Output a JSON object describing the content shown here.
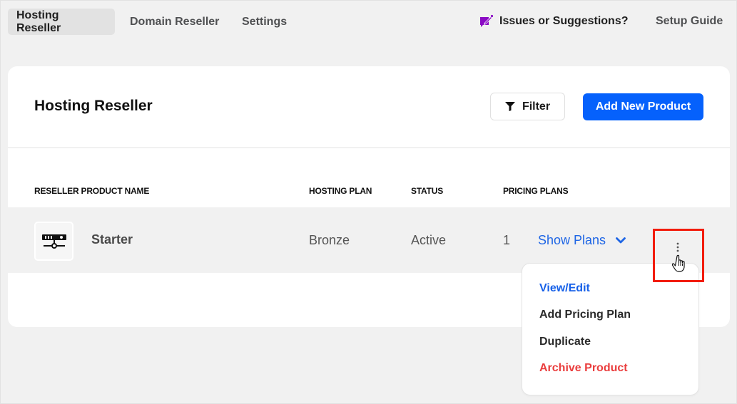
{
  "nav": {
    "tabs": [
      {
        "label": "Hosting Reseller",
        "active": true
      },
      {
        "label": "Domain Reseller",
        "active": false
      },
      {
        "label": "Settings",
        "active": false
      }
    ],
    "issues_label": "Issues or Suggestions?",
    "issues_icon": "feedback-pen-icon",
    "setup_label": "Setup Guide"
  },
  "card": {
    "title": "Hosting Reseller",
    "filter_label": "Filter",
    "filter_icon": "funnel-icon",
    "add_label": "Add New Product"
  },
  "table": {
    "columns": [
      "RESELLER PRODUCT NAME",
      "HOSTING PLAN",
      "STATUS",
      "PRICING PLANS"
    ],
    "rows": [
      {
        "icon": "server-network-icon",
        "name": "Starter",
        "hosting_plan": "Bronze",
        "status": "Active",
        "pricing_plans": "1",
        "show_plans_label": "Show Plans"
      }
    ]
  },
  "menu": {
    "items": [
      {
        "label": "View/Edit",
        "color": "#1660e8"
      },
      {
        "label": "Add Pricing Plan",
        "color": "#2a2a2a"
      },
      {
        "label": "Duplicate",
        "color": "#2a2a2a"
      },
      {
        "label": "Archive Product",
        "color": "#ea3d3d"
      }
    ]
  },
  "colors": {
    "accent": "#0561fc",
    "link": "#1f66e5",
    "danger": "#ea3d3d",
    "highlight": "#f21c0c",
    "issues_icon": "#8a0ac4"
  }
}
